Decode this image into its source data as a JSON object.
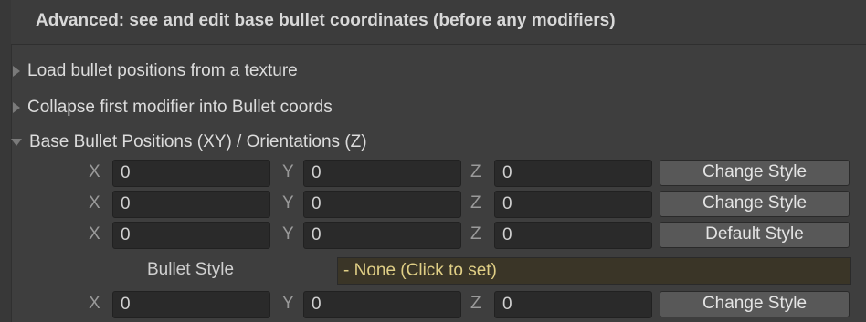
{
  "header": {
    "title": "Advanced: see and edit base bullet coordinates (before any modifiers)"
  },
  "foldouts": [
    {
      "label": "Load bullet positions from a texture",
      "expanded": false
    },
    {
      "label": "Collapse first modifier into Bullet coords",
      "expanded": false
    },
    {
      "label": "Base Bullet Positions (XY) / Orientations (Z)",
      "expanded": true
    }
  ],
  "labels": {
    "x": "X",
    "y": "Y",
    "z": "Z"
  },
  "bullets": [
    {
      "x": "0",
      "y": "0",
      "z": "0",
      "button": "Change Style"
    },
    {
      "x": "0",
      "y": "0",
      "z": "0",
      "button": "Change Style"
    },
    {
      "x": "0",
      "y": "0",
      "z": "0",
      "button": "Default Style"
    }
  ],
  "bullet_style": {
    "label": "Bullet Style",
    "value": "- None (Click to set)"
  },
  "bullets_after": [
    {
      "x": "0",
      "y": "0",
      "z": "0",
      "button": "Change Style"
    }
  ],
  "colors": {
    "background": "#3e3e3e",
    "field": "#2a2a2a",
    "button": "#585858",
    "style_field_text": "#e0cf86"
  }
}
